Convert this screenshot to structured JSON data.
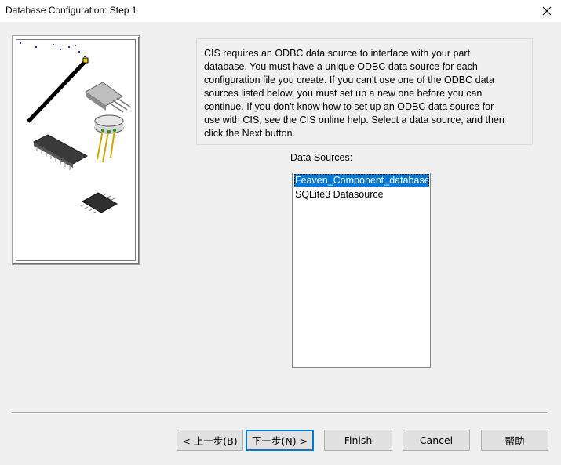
{
  "window": {
    "title": "Database Configuration: Step 1",
    "close_icon": "close-icon"
  },
  "illustration": {
    "icon": "electronic-components-icon"
  },
  "description": "CIS requires an ODBC data source to interface with your part\ndatabase. You must have a unique ODBC data source for each\nconfiguration file you create. If you can't use one of the ODBC data\nsources listed below, you must set up a new one before you can\ncontinue. If you don't know how to set up an ODBC data source for\nuse with CIS, see the CIS online help.  Select a data source, and then\nclick the Next button.",
  "data_sources": {
    "label": "Data Sources:",
    "items": [
      {
        "label": "Feaven_Component_database",
        "selected": true
      },
      {
        "label": "SQLite3 Datasource",
        "selected": false
      }
    ]
  },
  "buttons": {
    "back": "< 上一步(B)",
    "next": "下一步(N) >",
    "finish": "Finish",
    "cancel": "Cancel",
    "help": "帮助"
  },
  "colors": {
    "selection": "#0078d7",
    "dialog_bg": "#f0f0f0"
  }
}
